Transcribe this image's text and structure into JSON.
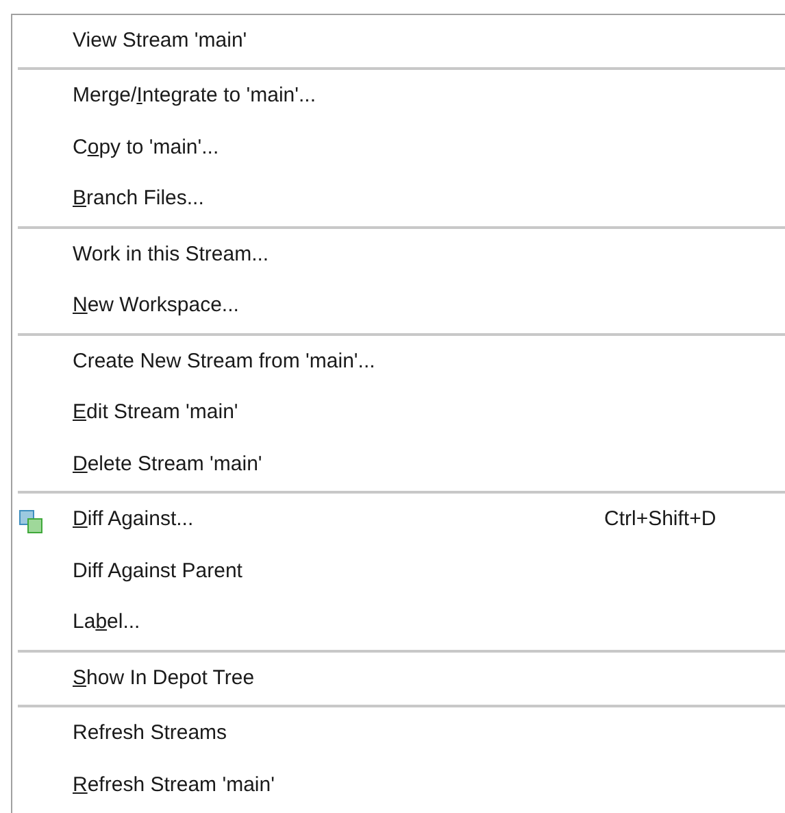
{
  "menu": {
    "items": [
      {
        "kind": "item",
        "label": "View Stream 'main'"
      },
      {
        "kind": "separator"
      },
      {
        "kind": "item",
        "text_before": "Merge/",
        "mnemonic": "I",
        "text_after": "ntegrate to 'main'..."
      },
      {
        "kind": "item",
        "text_before": "C",
        "mnemonic": "o",
        "text_after": "py to 'main'..."
      },
      {
        "kind": "item",
        "mnemonic": "B",
        "text_after": "ranch Files..."
      },
      {
        "kind": "separator"
      },
      {
        "kind": "item",
        "label": "Work in this Stream..."
      },
      {
        "kind": "item",
        "mnemonic": "N",
        "text_after": "ew Workspace..."
      },
      {
        "kind": "separator"
      },
      {
        "kind": "item",
        "label": "Create New Stream from 'main'..."
      },
      {
        "kind": "item",
        "mnemonic": "E",
        "text_after": "dit Stream 'main'"
      },
      {
        "kind": "item",
        "mnemonic": "D",
        "text_after": "elete Stream 'main'"
      },
      {
        "kind": "separator"
      },
      {
        "kind": "icon_item",
        "mnemonic": "D",
        "text_after": "iff Against...",
        "shortcut": "Ctrl+Shift+D"
      },
      {
        "kind": "item",
        "label": "Diff Against Parent"
      },
      {
        "kind": "item",
        "text_before": "La",
        "mnemonic": "b",
        "text_after": "el..."
      },
      {
        "kind": "separator"
      },
      {
        "kind": "item",
        "mnemonic": "S",
        "text_after": "how In Depot Tree"
      },
      {
        "kind": "separator"
      },
      {
        "kind": "item",
        "label": "Refresh Streams"
      },
      {
        "kind": "item",
        "mnemonic": "R",
        "text_after": "efresh Stream 'main'"
      }
    ]
  }
}
